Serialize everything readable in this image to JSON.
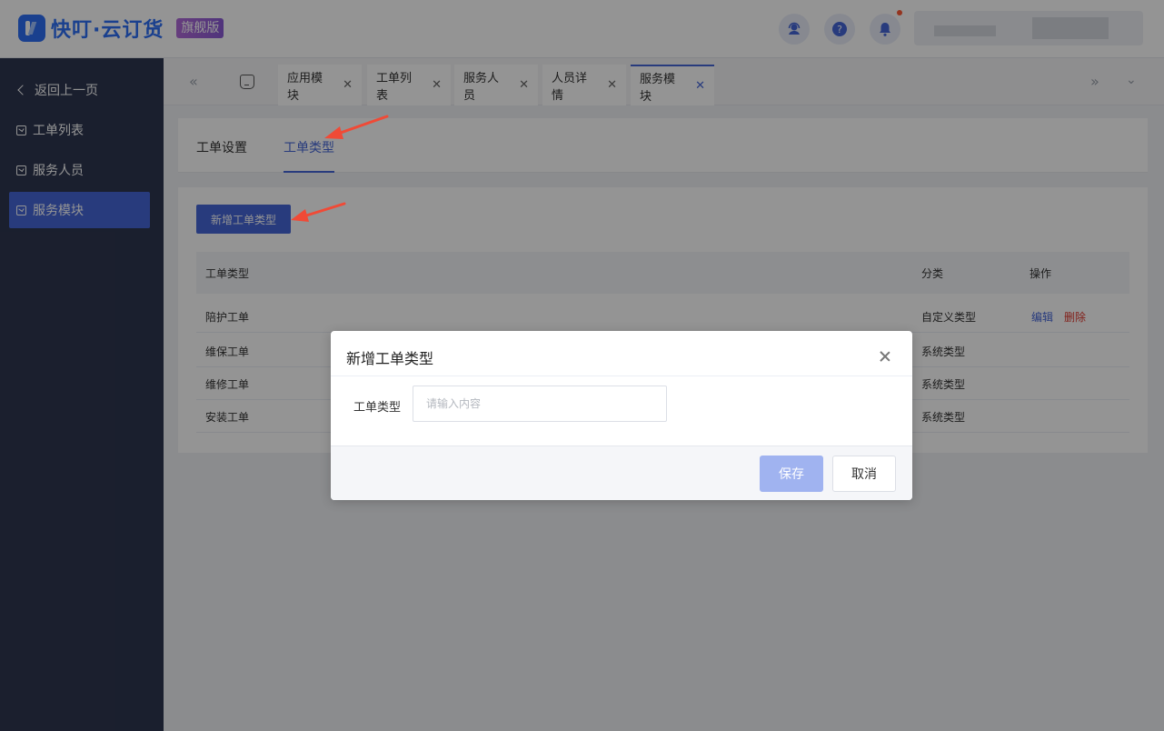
{
  "header": {
    "brand": "快叮·云订货",
    "edition_badge": "旗舰版",
    "icons": [
      "customer-service-icon",
      "help-icon",
      "bell-icon"
    ],
    "accent": "#4566d8"
  },
  "sidebar": {
    "back_label": "返回上一页",
    "items": [
      {
        "label": "工单列表",
        "active": false
      },
      {
        "label": "服务人员",
        "active": false
      },
      {
        "label": "服务模块",
        "active": true
      }
    ]
  },
  "tabs": [
    {
      "label": "应用模块",
      "active": false
    },
    {
      "label": "工单列表",
      "active": false
    },
    {
      "label": "服务人员",
      "active": false
    },
    {
      "label": "人员详情",
      "active": false
    },
    {
      "label": "服务模块",
      "active": true
    }
  ],
  "content_tabs": [
    {
      "label": "工单设置",
      "active": false
    },
    {
      "label": "工单类型",
      "active": true
    }
  ],
  "toolbar": {
    "add_label": "新增工单类型"
  },
  "table": {
    "columns": [
      "工单类型",
      "分类",
      "操作"
    ],
    "rows": [
      {
        "type": "陪护工单",
        "category": "自定义类型",
        "actions": [
          "编辑",
          "删除"
        ]
      },
      {
        "type": "维保工单",
        "category": "系统类型",
        "actions": []
      },
      {
        "type": "维修工单",
        "category": "系统类型",
        "actions": []
      },
      {
        "type": "安装工单",
        "category": "系统类型",
        "actions": []
      }
    ]
  },
  "modal": {
    "title": "新增工单类型",
    "field_label": "工单类型",
    "field_value": "",
    "field_placeholder": "请输入内容",
    "save_label": "保存",
    "cancel_label": "取消"
  }
}
